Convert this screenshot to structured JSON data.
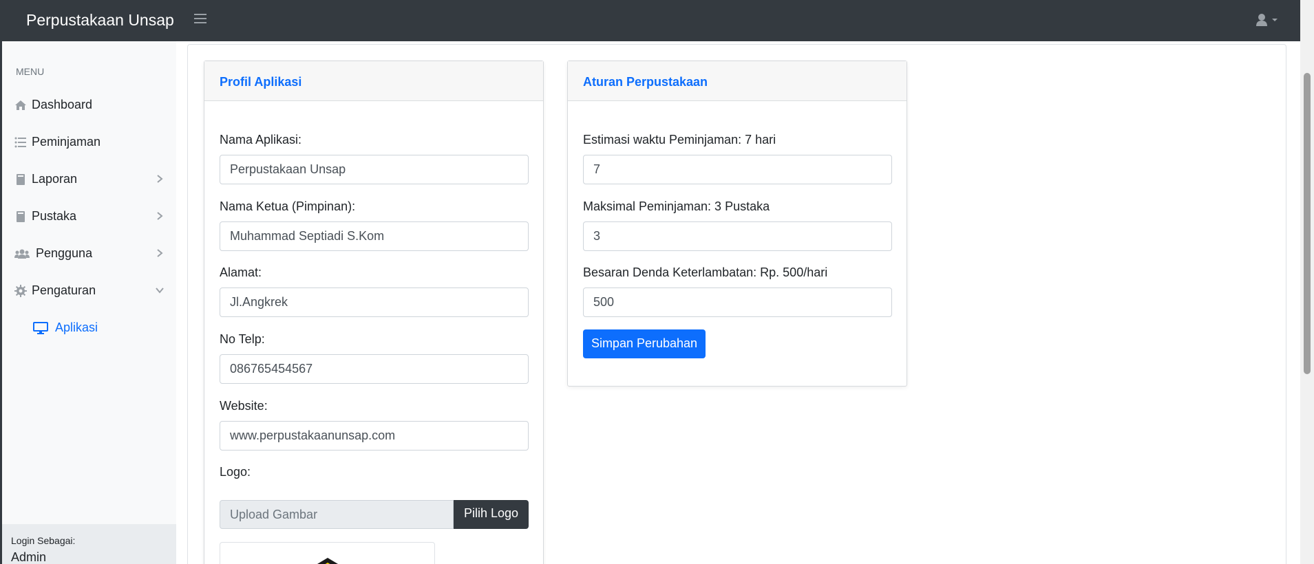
{
  "app": {
    "title": "Perpustakaan Unsap"
  },
  "sidebar": {
    "heading": "MENU",
    "items": [
      {
        "label": "Dashboard",
        "icon": "home-icon"
      },
      {
        "label": "Peminjaman",
        "icon": "list-icon"
      },
      {
        "label": "Laporan",
        "icon": "book-icon",
        "expandable": true
      },
      {
        "label": "Pustaka",
        "icon": "book-icon",
        "expandable": true
      },
      {
        "label": "Pengguna",
        "icon": "users-icon",
        "expandable": true
      },
      {
        "label": "Pengaturan",
        "icon": "gear-icon",
        "expanded": true
      }
    ],
    "subitems": [
      {
        "label": "Aplikasi",
        "icon": "monitor-icon",
        "active": true
      }
    ],
    "login_label": "Login Sebagai:",
    "login_user": "Admin"
  },
  "profil": {
    "title": "Profil Aplikasi",
    "fields": [
      {
        "label": "Nama Aplikasi:",
        "value": "Perpustakaan Unsap"
      },
      {
        "label": "Nama Ketua (Pimpinan):",
        "value": "Muhammad Septiadi S.Kom"
      },
      {
        "label": "Alamat:",
        "value": "Jl.Angkrek"
      },
      {
        "label": "No Telp:",
        "value": "086765454567"
      },
      {
        "label": "Website:",
        "value": "www.perpustakaanunsap.com"
      }
    ],
    "logo_label": "Logo:",
    "upload_placeholder": "Upload Gambar",
    "upload_button": "Pilih Logo"
  },
  "aturan": {
    "title": "Aturan Perpustakaan",
    "fields": [
      {
        "label": "Estimasi waktu Peminjaman: 7 hari",
        "value": "7"
      },
      {
        "label": "Maksimal Peminjaman: 3 Pustaka",
        "value": "3"
      },
      {
        "label": "Besaran Denda Keterlambatan: Rp. 500/hari",
        "value": "500"
      }
    ],
    "save_button": "Simpan Perubahan"
  },
  "colors": {
    "topbar": "#343a40",
    "accent": "#0d6efd",
    "sidebar": "#f8f9fa"
  }
}
